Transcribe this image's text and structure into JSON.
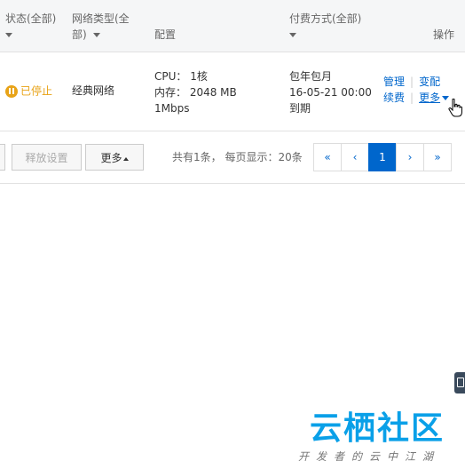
{
  "table": {
    "headers": {
      "status_line1": "状态(全部)",
      "network_line1": "网络类型(全",
      "network_line2": "部)",
      "config": "配置",
      "payment": "付费方式(全部)",
      "action": "操作"
    },
    "row": {
      "status": "已停止",
      "network": "经典网络",
      "cpu": "CPU： 1核",
      "memory": "内存： 2048 MB",
      "bandwidth": "1Mbps",
      "pay_type": "包年包月",
      "expire_date": "16-05-21 00:00",
      "expire_suffix": "到期",
      "action_manage": "管理",
      "action_change": "变配",
      "action_renew": "续费",
      "action_more": "更多"
    }
  },
  "footer": {
    "release_button": "释放设置",
    "more_button": "更多",
    "summary": "共有1条， 每页显示：20条",
    "pages": {
      "first": "«",
      "prev": "‹",
      "current": "1",
      "next": "›",
      "last": "»"
    }
  },
  "watermark": {
    "main": "云栖社区",
    "sub": "开发者的云中江湖"
  },
  "colors": {
    "status_stopped": "#e8a317",
    "link": "#0066cc",
    "pager_active": "#0066cc",
    "watermark": "#0aa0e8"
  }
}
